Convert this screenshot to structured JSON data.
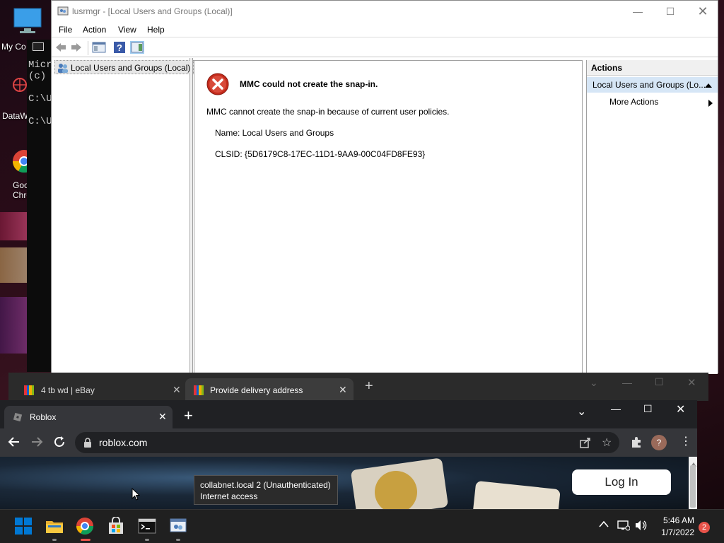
{
  "desktop": {
    "icons": [
      {
        "label": "My Co"
      },
      {
        "label": "DataW"
      },
      {
        "label": "Goo"
      },
      {
        "label": "Chro"
      }
    ]
  },
  "cmd": {
    "lines": [
      "Micr",
      "(c)",
      "C:\\U",
      "C:\\U"
    ]
  },
  "mmc": {
    "title": "lusrmgr - [Local Users and Groups (Local)]",
    "menu": [
      "File",
      "Action",
      "View",
      "Help"
    ],
    "tree_item": "Local Users and Groups (Local)",
    "error_title": "MMC could not create the snap-in.",
    "error_message": "MMC cannot create the snap-in because of current user policies.",
    "name_line": "Name: Local Users and Groups",
    "clsid_line": "CLSID: {5D6179C8-17EC-11D1-9AA9-00C04FD8FE93}",
    "actions_header": "Actions",
    "actions_sub": "Local Users and Groups (Lo...",
    "more_actions": "More Actions"
  },
  "chrome_back": {
    "tabs": [
      {
        "label": "4 tb wd | eBay"
      },
      {
        "label": "Provide delivery address"
      }
    ]
  },
  "chrome_front": {
    "tab": "Roblox",
    "url": "roblox.com",
    "login_label": "Log In"
  },
  "tooltip": {
    "line1": "collabnet.local 2 (Unauthenticated)",
    "line2": "Internet access"
  },
  "taskbar": {
    "time": "5:46 AM",
    "date": "1/7/2022",
    "notification_count": "2"
  },
  "colors": {
    "error_red": "#c42b1c",
    "action_highlight": "#d6e6f6",
    "chrome_dark": "#202124",
    "taskbar": "#202020",
    "windows_blue": "#0078d4"
  }
}
